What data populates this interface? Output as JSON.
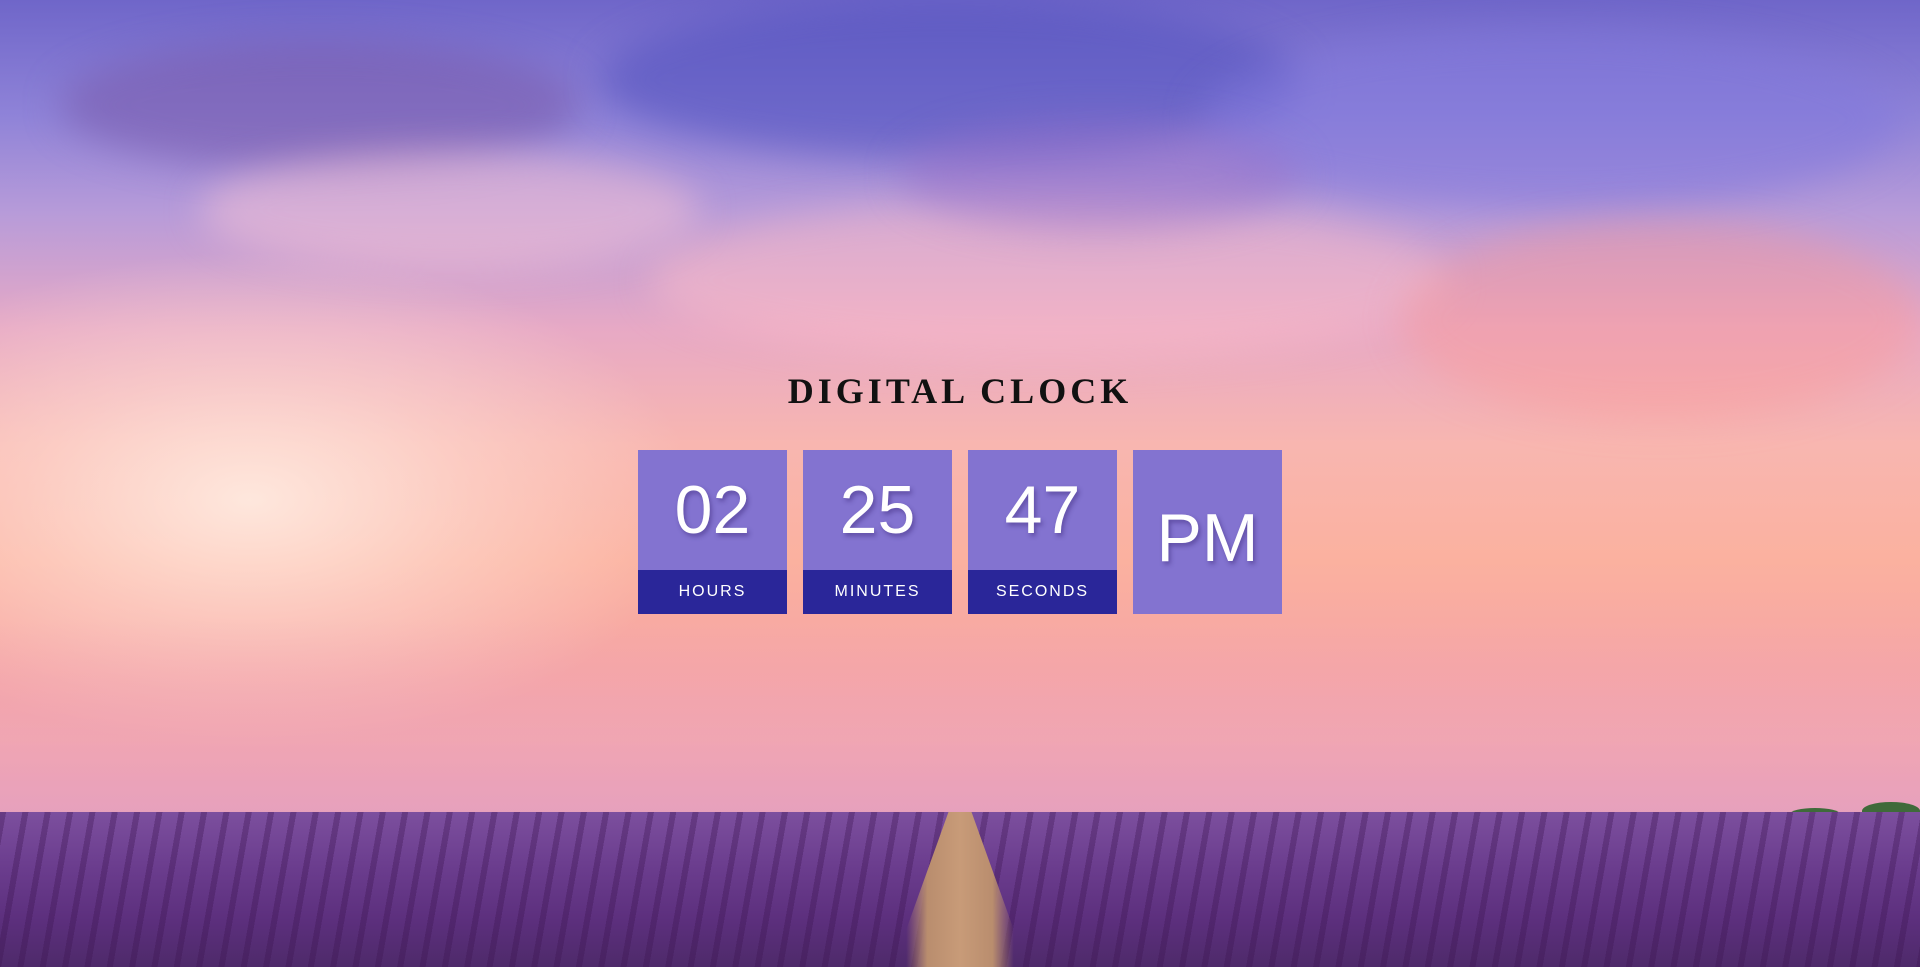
{
  "page": {
    "title": "DIGITAL CLOCK"
  },
  "clock": {
    "hours": {
      "value": "02",
      "label": "HOURS"
    },
    "minutes": {
      "value": "25",
      "label": "MINUTES"
    },
    "seconds": {
      "value": "47",
      "label": "SECONDS"
    },
    "period": {
      "value": "PM"
    }
  },
  "colors": {
    "tile": "#8373d0",
    "label_band": "#2a2699",
    "title": "#111111"
  }
}
